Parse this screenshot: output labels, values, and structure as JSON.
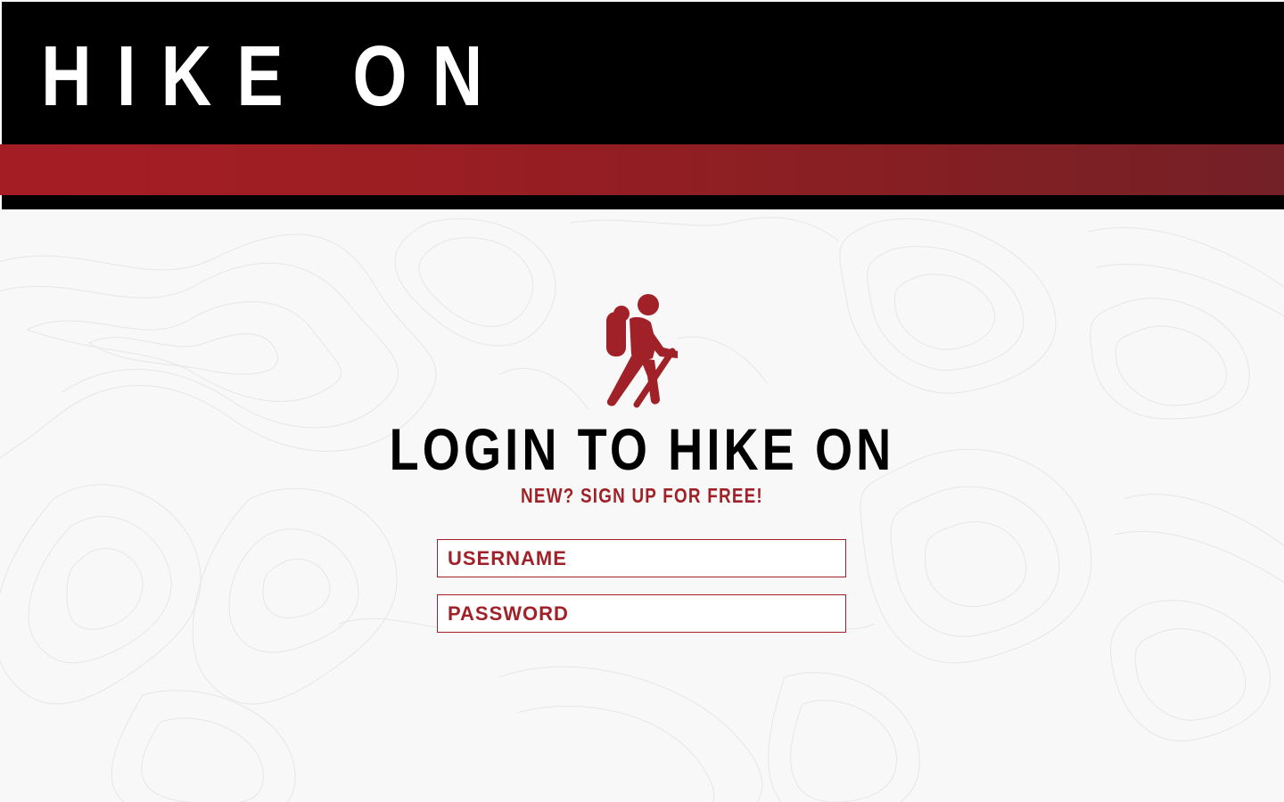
{
  "header": {
    "brand": "HIKE ON"
  },
  "login": {
    "title": "LOGIN TO HIKE ON",
    "signup_link": "NEW? SIGN UP FOR FREE!",
    "username": {
      "placeholder": "USERNAME",
      "value": ""
    },
    "password": {
      "placeholder": "PASSWORD",
      "value": ""
    }
  },
  "icons": {
    "hiker": "hiker-icon"
  },
  "colors": {
    "header_bg": "#000000",
    "accent_red": "#a02127",
    "stripe_start": "#a51d24",
    "stripe_end": "#732026",
    "page_bg": "#f8f8f8"
  }
}
